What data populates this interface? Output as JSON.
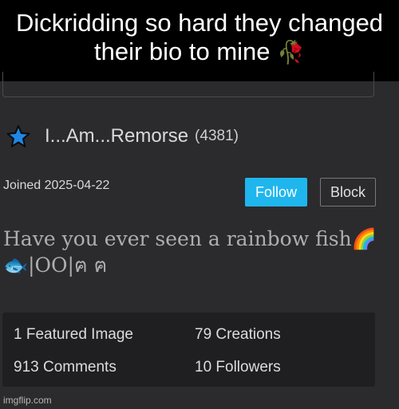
{
  "caption": {
    "text": "Dickridding so hard they changed their bio to mine",
    "emoji": "🥀"
  },
  "profile": {
    "icon": "blue-star-icon",
    "username": "I...Am...Remorse",
    "points": "(4381)",
    "joined": "Joined 2025-04-22",
    "follow_label": "Follow",
    "block_label": "Block",
    "bio": "Have you ever seen a rainbow fish🌈🐟|OO|ฅ ฅ"
  },
  "stats": {
    "featured": "1 Featured Image",
    "creations": "79 Creations",
    "comments": "913 Comments",
    "followers": "10 Followers"
  },
  "watermark": "imgflip.com",
  "colors": {
    "follow_button": "#1fb6ee",
    "star": "#1e88e5",
    "background": "#2b2b2d"
  }
}
